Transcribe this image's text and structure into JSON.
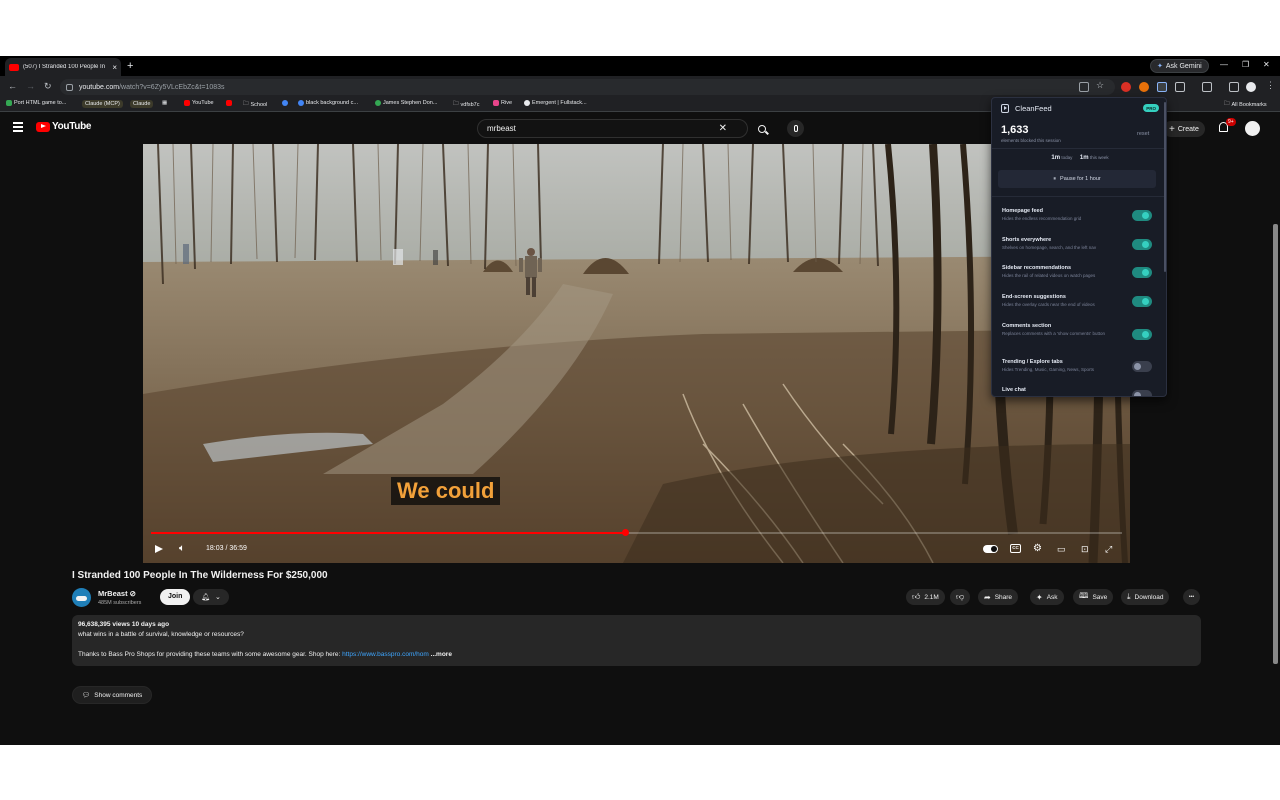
{
  "browser": {
    "tab_title": "(507) I Stranded 100 People In T",
    "tab_close": "×",
    "new_tab": "+",
    "gemini_label": "Ask Gemini",
    "url_host": "youtube.com",
    "url_path": "/watch?v=6Zy5VLcEbZc&t=1083s",
    "all_bookmarks": "All Bookmarks",
    "bookmarks": [
      {
        "label": "Port HTML game to...",
        "color": "#34a853"
      },
      {
        "label": "Claude (MCP)",
        "color": "#d97757"
      },
      {
        "label": "Claude",
        "color": "#d97757"
      },
      {
        "label": "",
        "color": "#9aa0a6"
      },
      {
        "label": "YouTube",
        "color": "#ff0000"
      },
      {
        "label": "",
        "color": "#ff0000"
      },
      {
        "label": "School",
        "color": "#9aa0a6"
      },
      {
        "label": "",
        "color": "#4285f4"
      },
      {
        "label": "black background c...",
        "color": "#4285f4"
      },
      {
        "label": "James Stephen Don...",
        "color": "#34a853"
      },
      {
        "label": "vdfsb7c",
        "color": "#9aa0a6"
      },
      {
        "label": "Rive",
        "color": "#e8458b"
      },
      {
        "label": "Emergent | Fullstack...",
        "color": "#e8eaed"
      }
    ]
  },
  "youtube": {
    "logo_text": "YouTube",
    "search_query": "mrbeast",
    "clear_glyph": "✕",
    "create_label": "Create",
    "create_glyph": "+",
    "notif_count": "9+"
  },
  "video": {
    "caption": "We could",
    "time": "18:03 / 36:59",
    "progress_fraction": 0.488,
    "title": "I Stranded 100 People In The Wilderness For $250,000"
  },
  "channel": {
    "name": "MrBeast ⊘",
    "subscribers": "485M subscribers",
    "join_label": "Join",
    "bell_glyph": "🔔︎",
    "chevron": "⌄"
  },
  "actions": {
    "likes": "2.1M",
    "share": "Share",
    "ask": "Ask",
    "save": "Save",
    "download": "Download",
    "more": "•••"
  },
  "description": {
    "meta": "96,638,395 views  10 days ago",
    "line1": "what wins in a battle of survival, knowledge or resources?",
    "line2_text": "Thanks to Bass Pro Shops for providing these teams with some awesome gear. Shop here: ",
    "line2_link": "https://www.basspro.com/hom",
    "line2_more": "...more"
  },
  "comments": {
    "show_label": "Show comments",
    "glyph": "💬︎"
  },
  "cleanfeed": {
    "title": "CleanFeed",
    "pro": "PRO",
    "count": "1,633",
    "count_label": "elements blocked this session",
    "reset": "reset",
    "today_value": "1m",
    "today_label": "today",
    "week_value": "1m",
    "week_label": "this week",
    "pause_label": "Pause for 1 hour",
    "pause_glyph": "⏸︎",
    "settings": [
      {
        "name": "Homepage feed",
        "sub": "Hides the endless recommendation grid",
        "on": true
      },
      {
        "name": "Shorts everywhere",
        "sub": "Shelves on homepage, search, and the left nav",
        "on": true
      },
      {
        "name": "Sidebar recommendations",
        "sub": "Hides the rail of related videos on watch pages",
        "on": true
      },
      {
        "name": "End-screen suggestions",
        "sub": "Hides the overlay cards near the end of videos",
        "on": true
      },
      {
        "name": "Comments section",
        "sub": "Replaces comments with a 'show comments' button",
        "on": true
      },
      {
        "name": "Trending / Explore tabs",
        "sub": "Hides Trending, Music, Gaming, News, Sports",
        "on": false
      },
      {
        "name": "Live chat",
        "sub": "",
        "on": false
      }
    ]
  },
  "colors": {
    "accent": "#35d0c0",
    "yt_red": "#ff0000",
    "caption": "#f2a13a"
  }
}
